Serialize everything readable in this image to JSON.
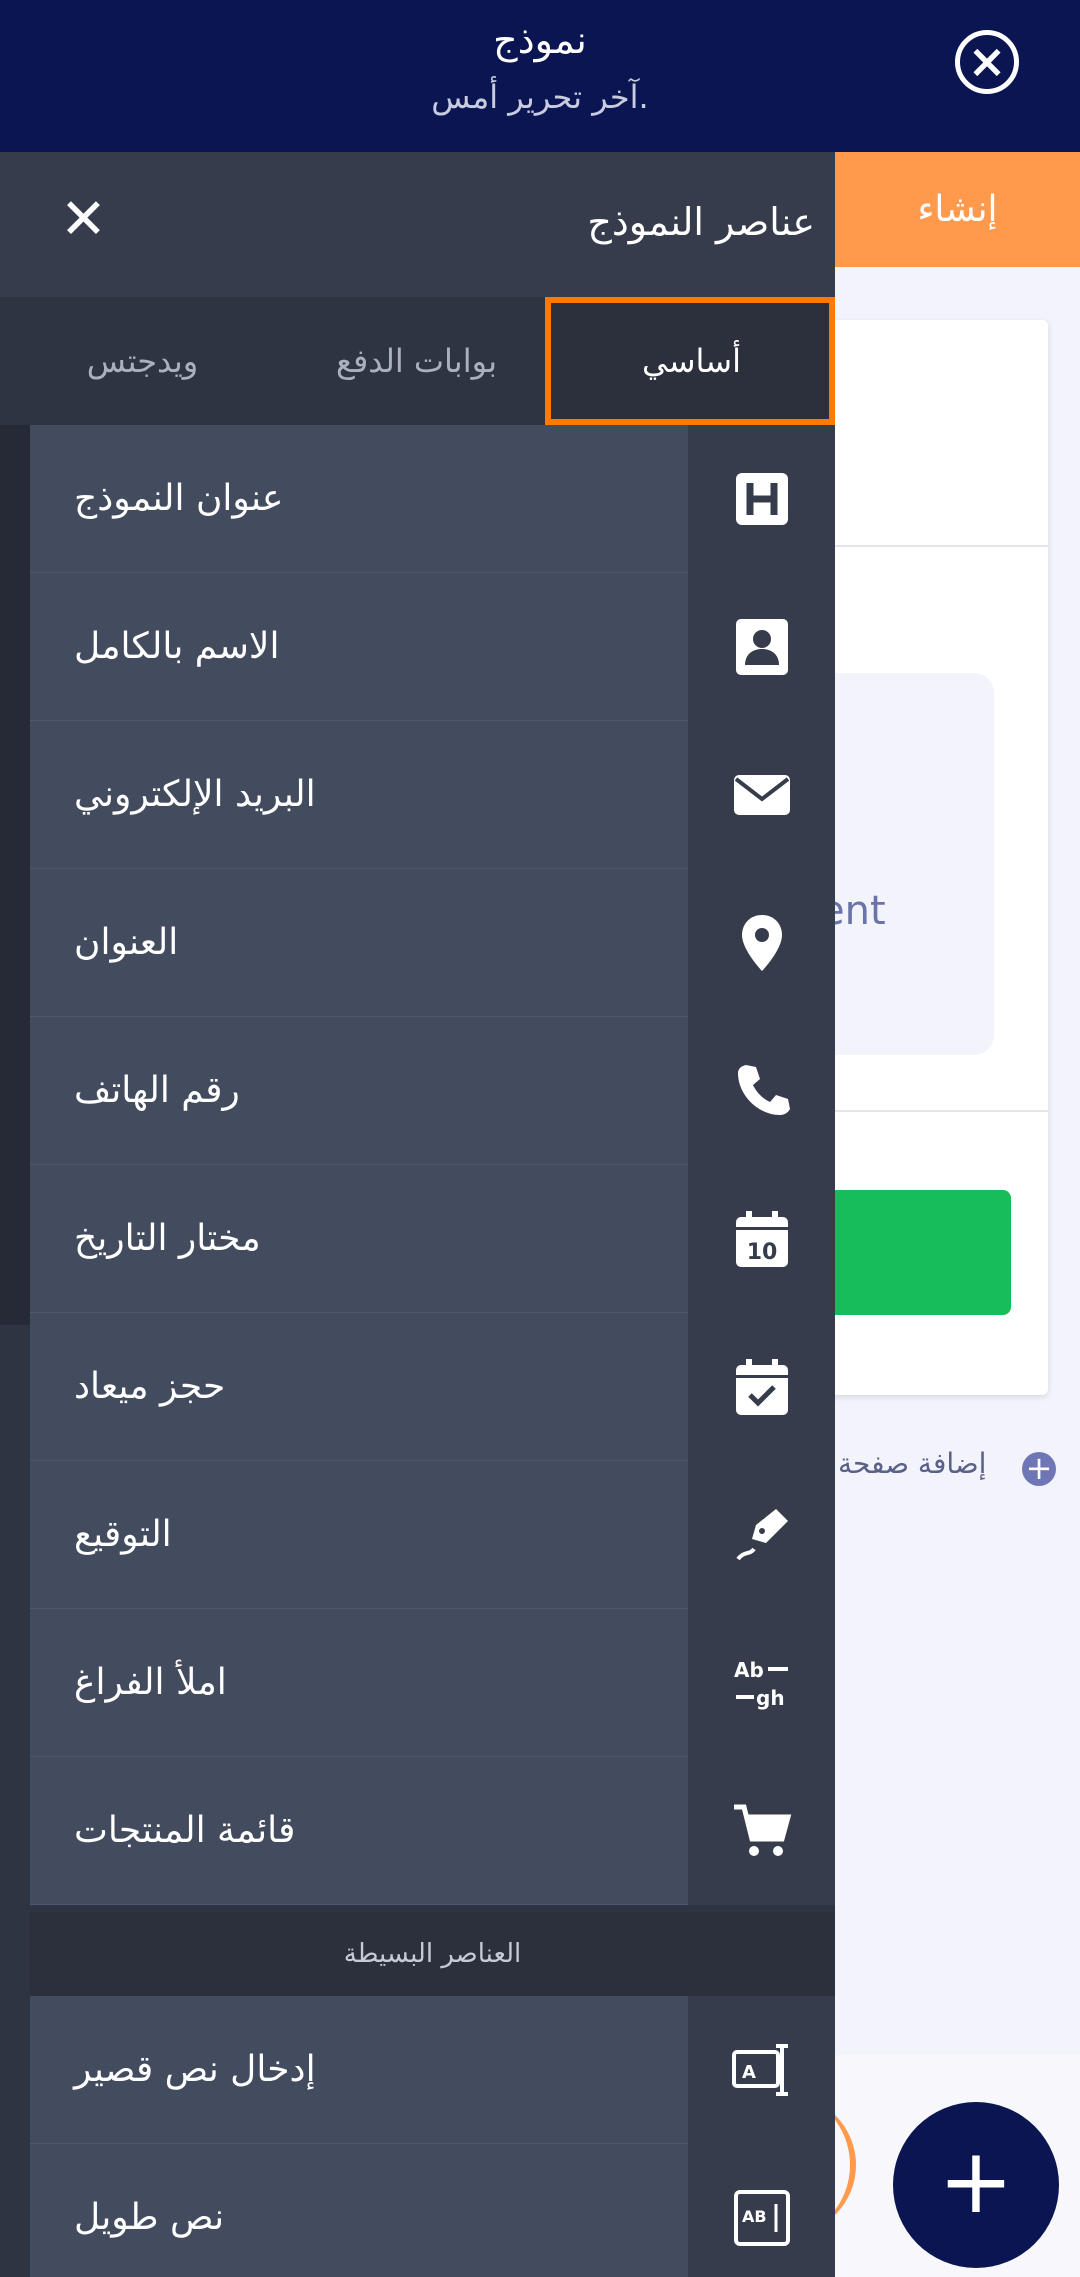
{
  "header": {
    "form_title": "نموذج",
    "last_edited": "آخر تحرير أمس."
  },
  "background": {
    "create_label": "إنشاء",
    "inner_text": "ent",
    "add_page": "إضافة صفحة"
  },
  "drawer": {
    "title": "عناصر النموذج",
    "tabs": {
      "basic": "أساسي",
      "payment": "بوابات الدفع",
      "widgets": "ويدجتس"
    },
    "items": [
      {
        "label": "عنوان النموذج",
        "icon": "heading-icon"
      },
      {
        "label": "الاسم بالكامل",
        "icon": "person-icon"
      },
      {
        "label": "البريد الإلكتروني",
        "icon": "envelope-icon"
      },
      {
        "label": "العنوان",
        "icon": "location-pin-icon"
      },
      {
        "label": "رقم الهاتف",
        "icon": "phone-icon"
      },
      {
        "label": "مختار التاريخ",
        "icon": "calendar-10-icon"
      },
      {
        "label": "حجز ميعاد",
        "icon": "calendar-check-icon"
      },
      {
        "label": "التوقيع",
        "icon": "signature-pen-icon"
      },
      {
        "label": "املأ الفراغ",
        "icon": "fill-blank-icon"
      },
      {
        "label": "قائمة المنتجات",
        "icon": "cart-icon"
      }
    ],
    "section_header": "العناصر البسيطة",
    "simple_items": [
      {
        "label": "إدخال نص قصير",
        "icon": "short-text-icon"
      },
      {
        "label": "نص طويل",
        "icon": "long-text-icon"
      }
    ]
  },
  "colors": {
    "top_bar": "#0a1551",
    "accent_orange": "#ff7a00",
    "drawer_bg": "#2f3442",
    "item_bg": "#434b5e",
    "green_button": "#18bd5b"
  }
}
